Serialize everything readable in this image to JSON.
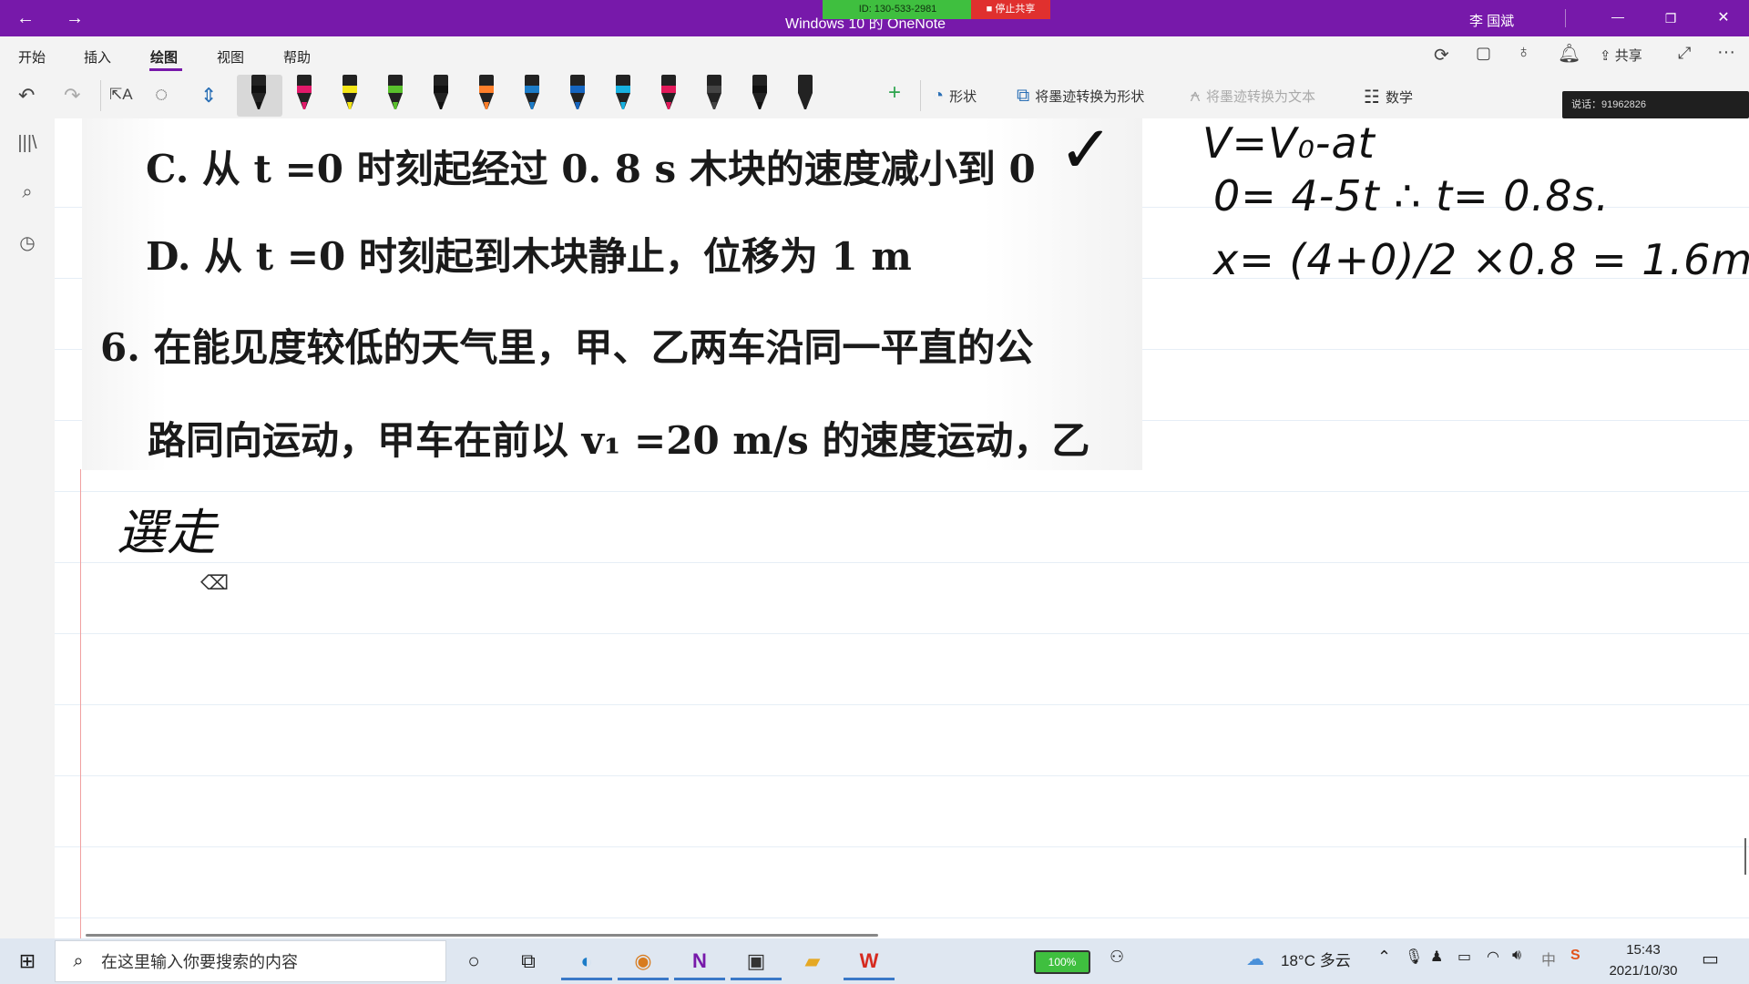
{
  "titlebar": {
    "title": "Windows 10 的 OneNote",
    "user": "李 国斌",
    "back": "←",
    "forward": "→",
    "minimize": "—",
    "restore": "❐",
    "close": "✕",
    "share_id": "ID: 130-533-2981",
    "share_stop": "停止共享"
  },
  "tabs": [
    "开始",
    "插入",
    "绘图",
    "视图",
    "帮助"
  ],
  "active_tab": "绘图",
  "top_right": {
    "share_label": "共享"
  },
  "toolbar": {
    "shape_label": "形状",
    "ink_to_shape_label": "将墨迹转换为形状",
    "ink_to_text_label": "将墨迹转换为文本",
    "math_label": "数学",
    "pens": [
      {
        "color": "#111111"
      },
      {
        "color": "#e2196a"
      },
      {
        "color": "#f4e617"
      },
      {
        "color": "#59c02c"
      },
      {
        "color": "#111111"
      },
      {
        "color": "#ff7f2a"
      },
      {
        "color": "#1c7cc8"
      },
      {
        "color": "#1565c0"
      },
      {
        "color": "#17b1e0"
      },
      {
        "color": "#e21a5a"
      },
      {
        "color": "#444444"
      },
      {
        "color": "#111111"
      },
      {
        "color": "#222222"
      }
    ]
  },
  "meeting_tip": "说话：91962826",
  "page": {
    "scan_lines": [
      "C. 从 t =0 时刻起经过 0. 8 s 木块的速度减小到 0",
      "D. 从 t =0 时刻起到木块静止，位移为 1 m",
      "6. 在能见度较低的天气里，甲、乙两车沿同一平直的公",
      "路同向运动，甲车在前以 v₁ =20 m/s 的速度运动，乙"
    ],
    "check_mark": "✓",
    "handwriting": [
      "V=V₀-at",
      "0= 4-5t  ∴ t= 0.8s.",
      "x= (4+0)/2 ×0.8 = 1.6m."
    ],
    "handwriting_note": "選走"
  },
  "taskbar": {
    "search_placeholder": "在这里输入你要搜索的内容",
    "battery": "100%",
    "weather": "18°C 多云",
    "time": "15:43",
    "date": "2021/10/30",
    "ime": "中"
  }
}
